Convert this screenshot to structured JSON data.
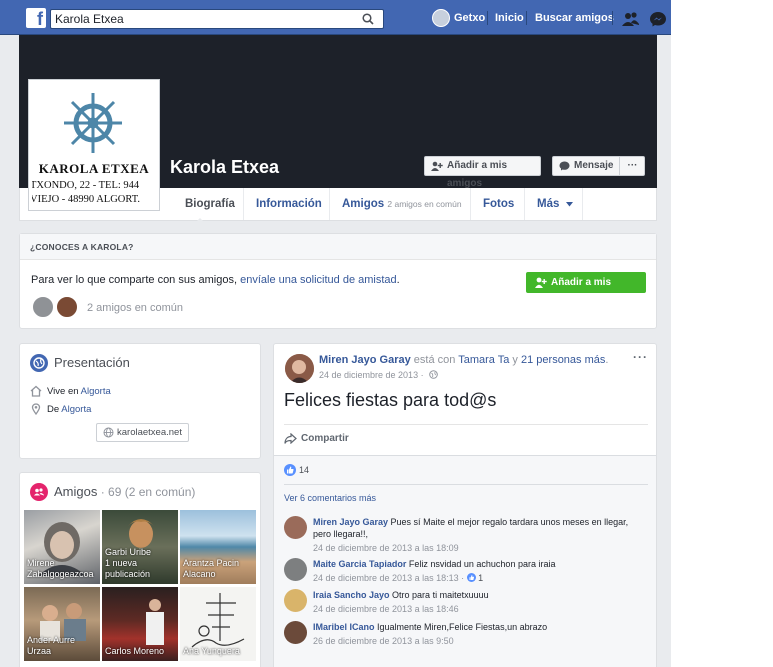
{
  "topbar": {
    "search_value": "Karola Etxea",
    "user_name": "Getxo",
    "home_label": "Inicio",
    "find_friends_label": "Buscar amigos"
  },
  "profile": {
    "logo_name": "KAROLA ETXEA",
    "logo_address_1": "TXONDO, 22 - TEL: 944",
    "logo_address_2": "VIEJO - 48990 ALGORT.",
    "name": "Karola Etxea",
    "add_friend_label": "Añadir a mis amigos",
    "message_label": "Mensaje",
    "more_label": "···"
  },
  "tabs": {
    "biography": "Biografía",
    "info": "Información",
    "friends": "Amigos",
    "friends_sub": "2 amigos en común",
    "photos": "Fotos",
    "more": "Más"
  },
  "know": {
    "title": "¿CONOCES A KAROLA?",
    "text": "Para ver lo que comparte con sus amigos, ",
    "link": "envíale una solicitud de amistad",
    "end": ".",
    "button": "Añadir a mis amigos",
    "mutual": "2 amigos en común"
  },
  "presentation": {
    "title": "Presentación",
    "lives_prefix": "Vive en ",
    "lives_place": "Algorta",
    "from_prefix": "De ",
    "from_place": "Algorta",
    "website": "karolaetxea.net"
  },
  "friends": {
    "title": "Amigos",
    "count": " · 69 (2 en común)",
    "tiles": [
      {
        "name": "Mirene Zabalgogeazcoa"
      },
      {
        "name": "Garbi Uribe\n1 nueva publicación"
      },
      {
        "name": "Arantza Pacin Alacano"
      },
      {
        "name": "Ander Aurre Urzaa"
      },
      {
        "name": "Carlos Moreno"
      },
      {
        "name": "Ana Yunquera"
      }
    ]
  },
  "post": {
    "author": "Miren Jayo Garay",
    "with_text": " está con ",
    "tagged": "Tamara Ta",
    "and_text": " y ",
    "others": "21 personas más",
    "end": ".",
    "date": "24 de diciembre de 2013 ·",
    "text": "Felices fiestas para tod@s",
    "share": "Compartir",
    "likes": "14",
    "more_comments": "Ver 6 comentarios más",
    "more_menu": "···"
  },
  "comments": [
    {
      "name": "Miren Jayo Garay",
      "text": " Pues sí Maite el mejor regalo tardara unos meses en llegar, pero llegara!!,",
      "date": "24 de diciembre de 2013 a las 18:09"
    },
    {
      "name": "Maite Garcia Tapiador",
      "text": " Feliz nsvidad un achuchon para iraia",
      "date": "24 de diciembre de 2013 a las 18:13 ·",
      "likes": "1"
    },
    {
      "name": "Iraia Sancho Jayo",
      "text": " Otro para ti maitetxuuuu",
      "date": "24 de diciembre de 2013 a las 18:46"
    },
    {
      "name": "IMaribel ICano",
      "text": " Igualmente Miren,Felice Fiestas,un abrazo",
      "date": "26 de diciembre de 2013 a las 9:50"
    }
  ],
  "colors": {
    "brand": "#4267b2",
    "link": "#365899",
    "green": "#42b72a",
    "cover": "#1d2129"
  }
}
